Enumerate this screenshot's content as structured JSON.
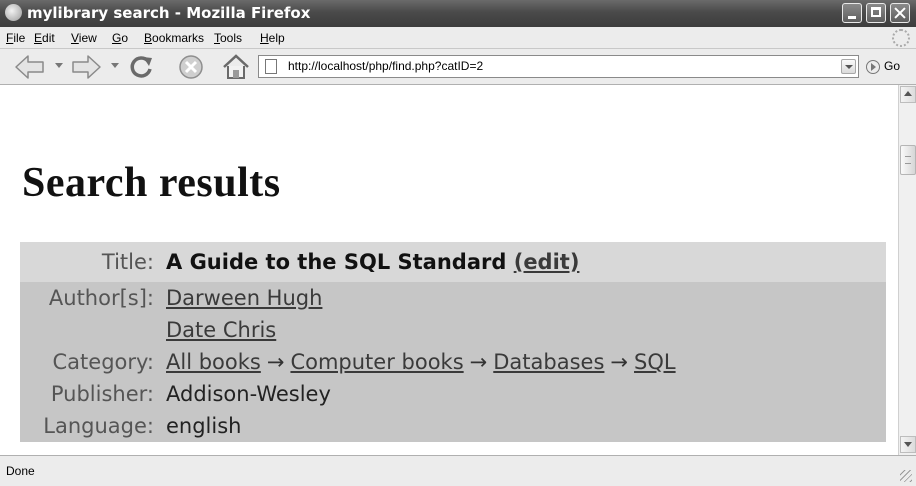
{
  "window": {
    "title": "mylibrary search - Mozilla Firefox"
  },
  "menu": [
    {
      "acc": "F",
      "rest": "ile"
    },
    {
      "acc": "E",
      "rest": "dit"
    },
    {
      "acc": "V",
      "rest": "iew"
    },
    {
      "acc": "G",
      "rest": "o"
    },
    {
      "acc": "B",
      "rest": "ookmarks"
    },
    {
      "acc": "T",
      "rest": "ools"
    },
    {
      "acc": "H",
      "rest": "elp"
    }
  ],
  "navigation": {
    "url": "http://localhost/php/find.php?catID=2",
    "go_label": "Go"
  },
  "page": {
    "heading": "Search results",
    "record": {
      "title_label": "Title:",
      "title": "A Guide to the SQL Standard",
      "edit_link": "(edit)",
      "author_label": "Author[s]:",
      "authors": [
        "Darween Hugh",
        "Date Chris"
      ],
      "category_label": "Category:",
      "category_path": [
        "All books",
        "Computer books",
        "Databases",
        "SQL"
      ],
      "category_separator": "→",
      "publisher_label": "Publisher:",
      "publisher": "Addison-Wesley",
      "language_label": "Language:",
      "language": "english"
    }
  },
  "status": {
    "text": "Done"
  }
}
